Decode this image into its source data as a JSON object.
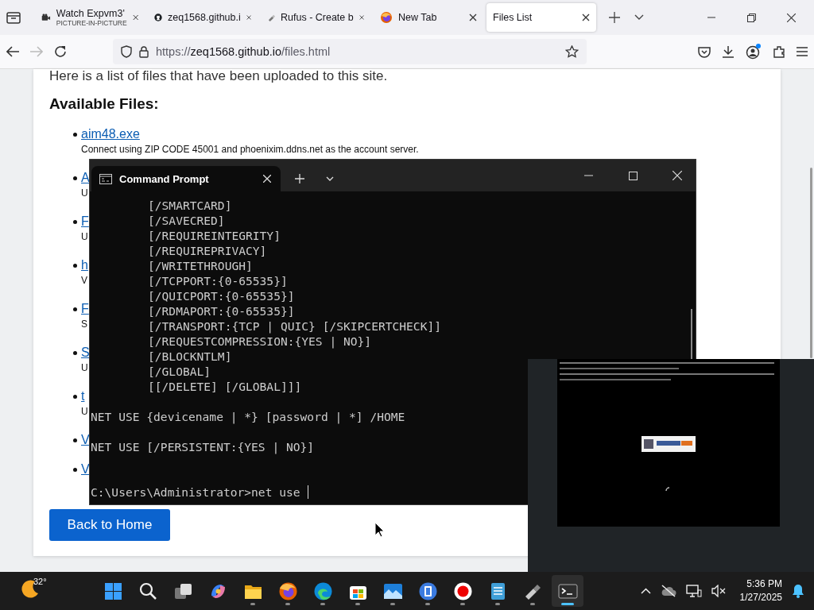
{
  "browser": {
    "tabs": [
      {
        "kind": "video",
        "title": "Watch Expvm3'",
        "subtitle": "PICTURE-IN-PICTURE",
        "selected": false
      },
      {
        "kind": "cat",
        "title": "zeq1568.github.i",
        "selected": false
      },
      {
        "kind": "usb",
        "title": "Rufus - Create b",
        "selected": false
      },
      {
        "kind": "fox",
        "title": "New Tab",
        "selected": false
      },
      {
        "kind": "none",
        "title": "Files List",
        "selected": true
      }
    ],
    "forward_disabled": true,
    "url": {
      "scheme": "https://",
      "host": "zeq1568.github.io",
      "path": "/files.html"
    }
  },
  "page": {
    "intro": "Here is a list of files that have been uploaded to this site.",
    "heading": "Available Files:",
    "files": [
      {
        "name": "aim48.exe",
        "description": "Connect using ZIP CODE 45001 and phoenixim.ddns.net as the account server."
      },
      {
        "name": "A",
        "description": "U"
      },
      {
        "name": "F",
        "description": "U"
      },
      {
        "name": "h",
        "description": "V"
      },
      {
        "name": "F",
        "description": "S"
      },
      {
        "name": "S",
        "description": "U"
      },
      {
        "name": "t",
        "description": "U"
      },
      {
        "name": "V"
      },
      {
        "name": "V"
      }
    ],
    "back_button": "Back to Home"
  },
  "terminal": {
    "tab_title": "Command Prompt",
    "lines": [
      {
        "kind": "option",
        "text": "[/SMARTCARD]"
      },
      {
        "kind": "option",
        "text": "[/SAVECRED]"
      },
      {
        "kind": "option",
        "text": "[/REQUIREINTEGRITY]"
      },
      {
        "kind": "option",
        "text": "[/REQUIREPRIVACY]"
      },
      {
        "kind": "option",
        "text": "[/WRITETHROUGH]"
      },
      {
        "kind": "option",
        "text": "[/TCPPORT:{0-65535}]"
      },
      {
        "kind": "option",
        "text": "[/QUICPORT:{0-65535}]"
      },
      {
        "kind": "option",
        "text": "[/RDMAPORT:{0-65535}]"
      },
      {
        "kind": "option",
        "text": "[/TRANSPORT:{TCP | QUIC} [/SKIPCERTCHECK]]"
      },
      {
        "kind": "option",
        "text": "[/REQUESTCOMPRESSION:{YES | NO}]"
      },
      {
        "kind": "option",
        "text": "[/BLOCKNTLM]"
      },
      {
        "kind": "option",
        "text": "[/GLOBAL]"
      },
      {
        "kind": "option",
        "text": "[[/DELETE] [/GLOBAL]]]"
      },
      {
        "kind": "command",
        "text": "NET USE {devicename | *} [password | *] /HOME"
      },
      {
        "kind": "command",
        "text": "NET USE [/PERSISTENT:{YES | NO}]"
      },
      {
        "kind": "prompt",
        "text": "C:\\Users\\Administrator>net use"
      }
    ]
  },
  "taskbar": {
    "temperature": "32°",
    "apps": [
      {
        "kind": "start",
        "running": false,
        "active": false
      },
      {
        "kind": "search",
        "running": false,
        "active": false
      },
      {
        "kind": "taskview",
        "running": false,
        "active": false
      },
      {
        "kind": "copilot",
        "running": false,
        "active": false
      },
      {
        "kind": "folder",
        "running": true,
        "active": false
      },
      {
        "kind": "fox",
        "running": true,
        "active": false
      },
      {
        "kind": "edge",
        "running": true,
        "active": false
      },
      {
        "kind": "store",
        "running": true,
        "active": false
      },
      {
        "kind": "photos",
        "running": true,
        "active": false
      },
      {
        "kind": "film",
        "running": true,
        "active": false
      },
      {
        "kind": "record",
        "running": true,
        "active": false
      },
      {
        "kind": "notepad",
        "running": true,
        "active": false
      },
      {
        "kind": "usb",
        "running": true,
        "active": false
      },
      {
        "kind": "terminal",
        "running": true,
        "active": true
      }
    ],
    "time": "5:36 PM",
    "date": "1/27/2025"
  }
}
